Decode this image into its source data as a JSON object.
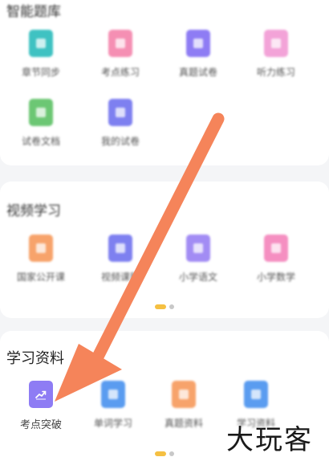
{
  "section1": {
    "title": "智能题库",
    "items": [
      {
        "label": "章节同步",
        "color": "#3fc2c2",
        "icon": "doc-icon"
      },
      {
        "label": "考点练习",
        "color": "#f58fb3",
        "icon": "doc-icon"
      },
      {
        "label": "真题试卷",
        "color": "#8e7cf4",
        "icon": "doc-icon"
      },
      {
        "label": "听力练习",
        "color": "#f3a3d8",
        "icon": "doc-icon"
      },
      {
        "label": "试卷文档",
        "color": "#6cc774",
        "icon": "doc-icon"
      },
      {
        "label": "我的试卷",
        "color": "#7e80f0",
        "icon": "doc-icon"
      }
    ]
  },
  "section2": {
    "title": "视频学习",
    "items": [
      {
        "label": "国家公开课",
        "color": "#f7a36b",
        "icon": "doc-icon"
      },
      {
        "label": "视频课程",
        "color": "#7e80f0",
        "icon": "doc-icon"
      },
      {
        "label": "小学语文",
        "color": "#a28cf4",
        "icon": "doc-icon"
      },
      {
        "label": "小学数学",
        "color": "#f58fc1",
        "icon": "doc-icon"
      }
    ]
  },
  "section3": {
    "title": "学习资料",
    "items": [
      {
        "label": "考点突破",
        "color": "#8e7cf4",
        "icon": "trend-icon"
      },
      {
        "label": "单词学习",
        "color": "#5a9cf0",
        "icon": "doc-icon"
      },
      {
        "label": "真题资料",
        "color": "#f7a36b",
        "icon": "doc-icon"
      },
      {
        "label": "学习资料",
        "color": "#5a9cf0",
        "icon": "doc-icon"
      }
    ]
  },
  "annotation": {
    "arrow_color": "#f5845a",
    "watermark": "大玩客"
  }
}
